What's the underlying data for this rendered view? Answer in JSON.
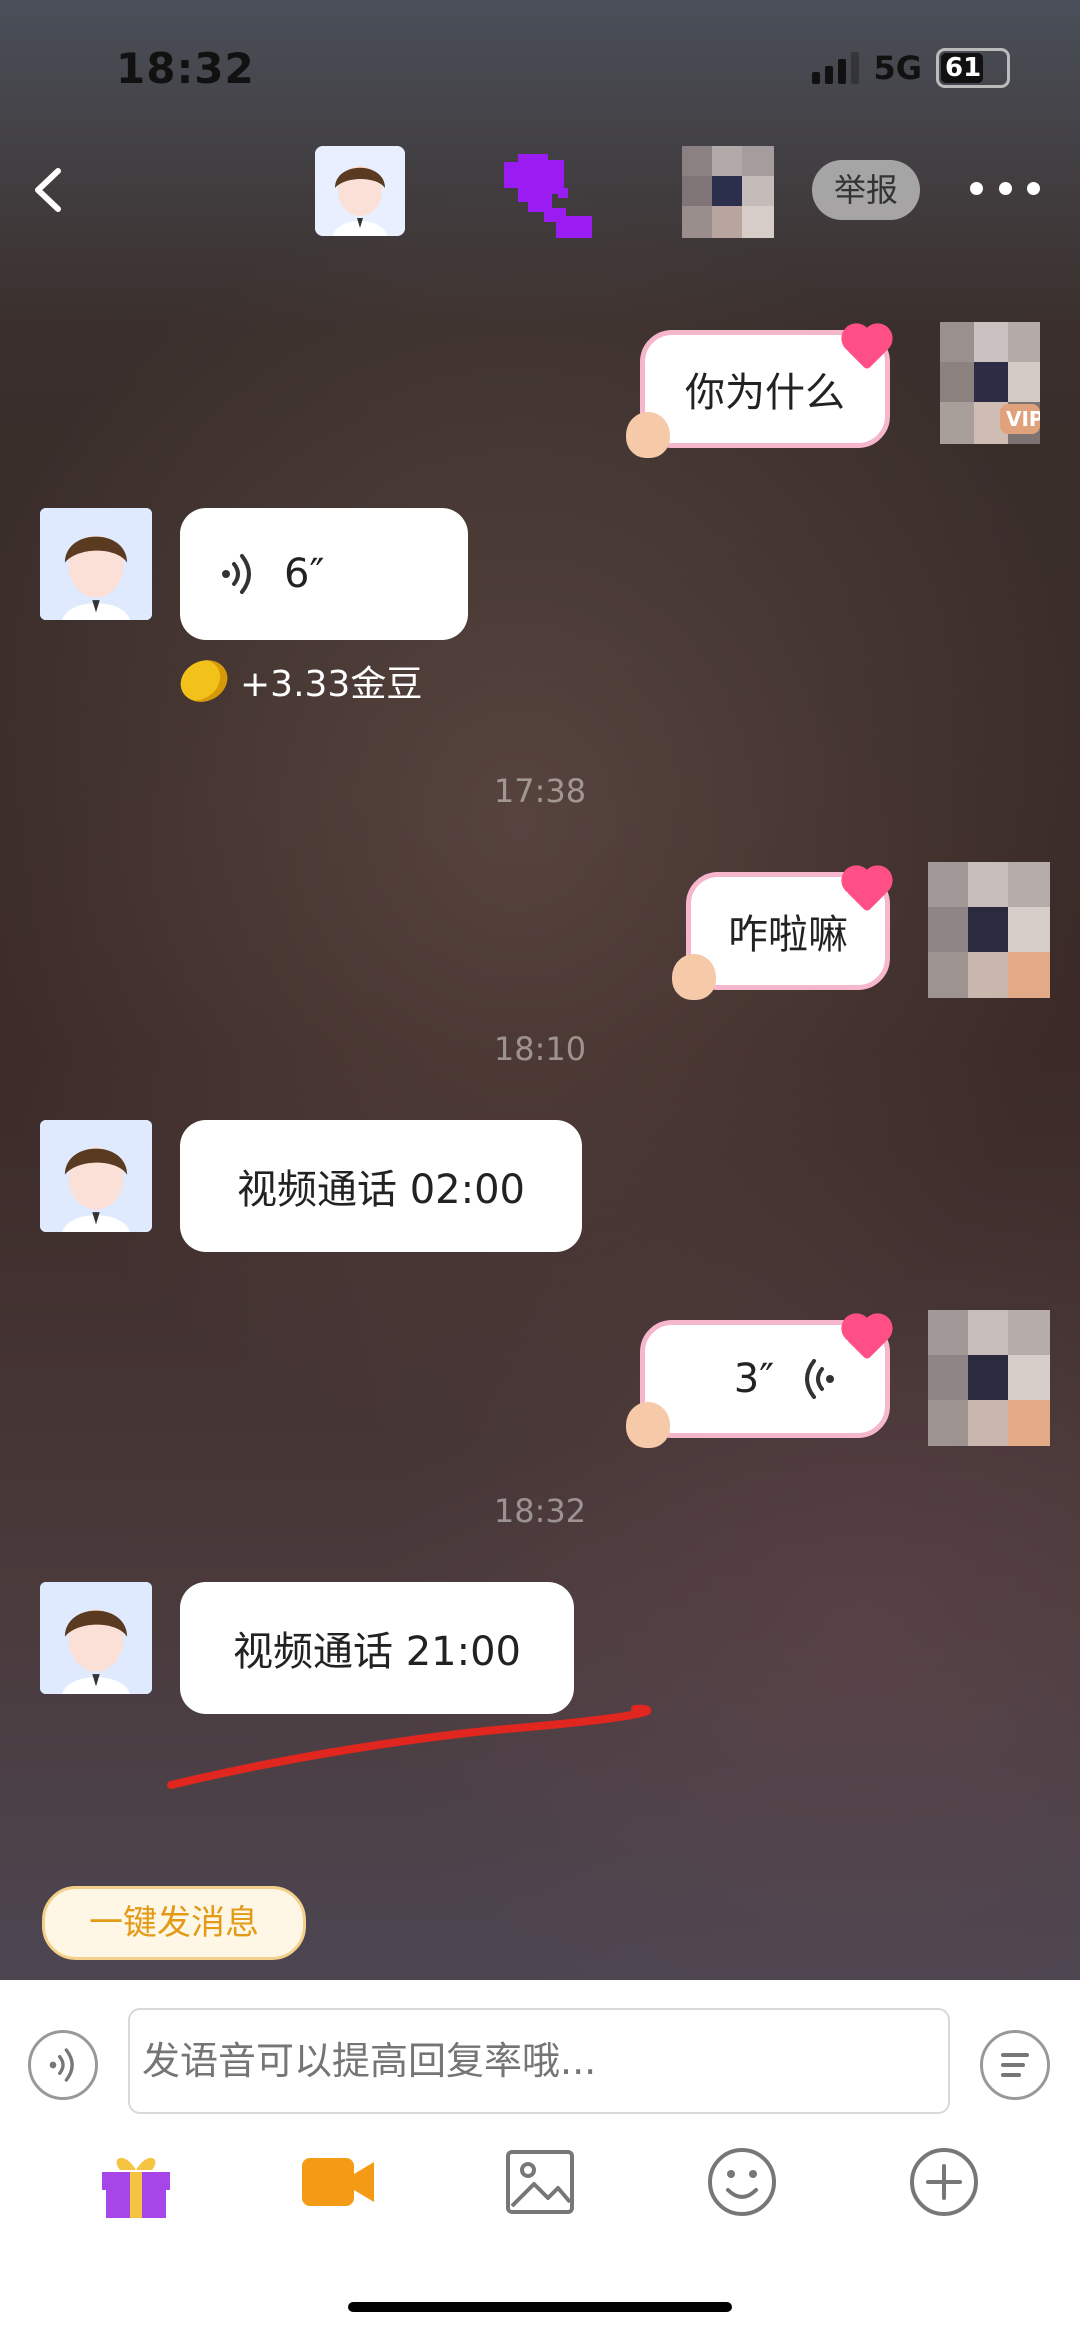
{
  "status_bar": {
    "time": "18:32",
    "network": "5G",
    "battery": "61"
  },
  "header": {
    "report_label": "举报"
  },
  "messages": [
    {
      "side": "right",
      "text": "你为什么"
    },
    {
      "side": "left",
      "type": "voice",
      "duration": "6″",
      "reward": "+3.33金豆"
    },
    {
      "timestamp": "17:38"
    },
    {
      "side": "right",
      "text": "咋啦嘛"
    },
    {
      "timestamp": "18:10"
    },
    {
      "side": "left",
      "text": "视频通话 02:00"
    },
    {
      "side": "right",
      "type": "voice",
      "duration": "3″"
    },
    {
      "timestamp": "18:32"
    },
    {
      "side": "left",
      "text": "视频通话 21:00"
    }
  ],
  "composer": {
    "quick_message_label": "一键发消息",
    "placeholder": "发语音可以提高回复率哦..."
  },
  "icons": {
    "back": "chevron-left-icon",
    "more": "more-dots-icon",
    "voice": "voice-icon",
    "menu": "menu-icon",
    "gift": "gift-icon",
    "video": "video-camera-icon",
    "image": "image-icon",
    "emoji": "emoji-icon",
    "add": "plus-icon"
  },
  "colors": {
    "accent_orange": "#f59a14",
    "gift_purple": "#a646e8",
    "underline_red": "#e0261e"
  }
}
